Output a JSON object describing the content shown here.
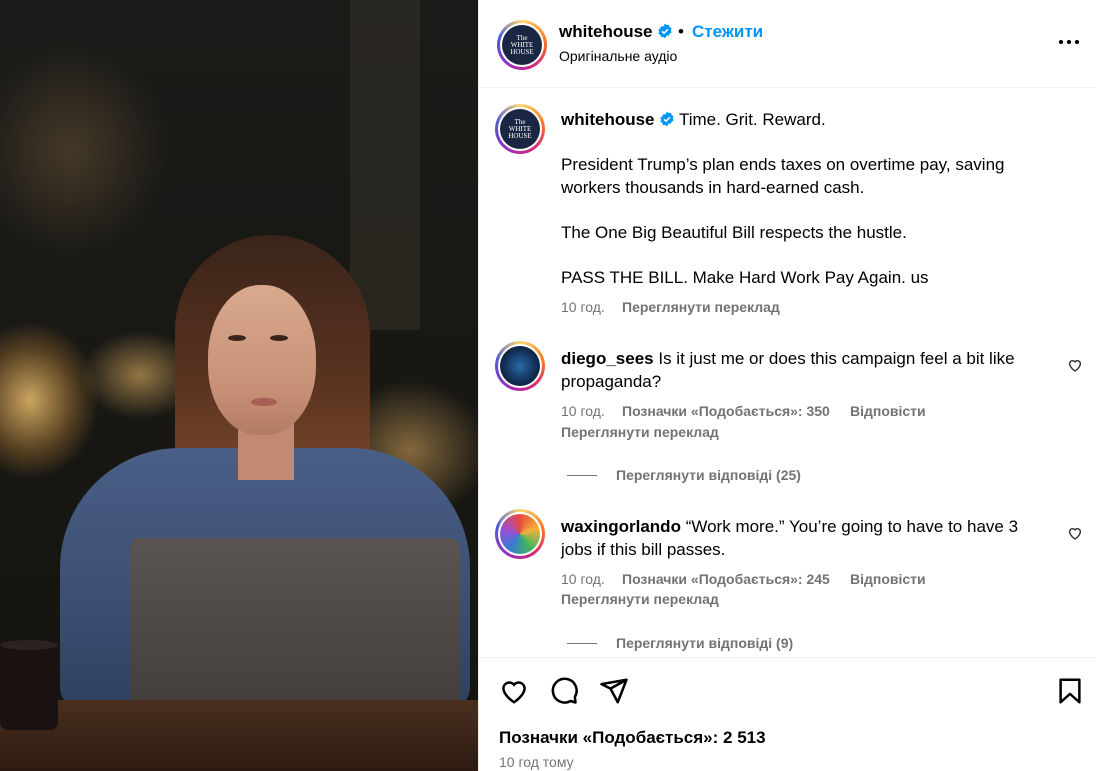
{
  "post": {
    "username": "whitehouse",
    "follow_label": "Стежити",
    "separator": "•",
    "audio_label": "Оригінальне аудіо",
    "avatar_text": [
      "The",
      "WHITE",
      "HOUSE"
    ]
  },
  "caption": {
    "username": "whitehouse",
    "first_line": "Time. Grit. Reward.",
    "paragraphs": [
      "President Trump’s plan ends taxes on overtime pay, saving workers thousands in hard-earned cash.",
      "The One Big Beautiful Bill respects the hustle.",
      "PASS THE BILL. Make Hard Work Pay Again. us"
    ],
    "time": "10 год.",
    "translate_label": "Переглянути переклад"
  },
  "comments": [
    {
      "username": "diego_sees",
      "text": "Is it just me or does this campaign feel a bit like propaganda?",
      "time": "10 год.",
      "likes": "Позначки «Подобається»: 350",
      "reply_label": "Відповісти",
      "translate_label": "Переглянути переклад",
      "view_replies": "Переглянути відповіді (25)"
    },
    {
      "username": "waxingorlando",
      "text": "“Work more.” You’re going to have to have 3 jobs if this bill passes.",
      "time": "10 год.",
      "likes": "Позначки «Подобається»: 245",
      "reply_label": "Відповісти",
      "translate_label": "Переглянути переклад",
      "view_replies": "Переглянути відповіді (9)"
    }
  ],
  "footer": {
    "likes": "Позначки «Подобається»: 2 513",
    "time_ago": "10 год тому"
  },
  "icons": {
    "more": "more-options-icon",
    "verified": "verified-badge-icon",
    "like": "heart-icon",
    "comment": "comment-icon",
    "share": "share-icon",
    "save": "bookmark-icon"
  },
  "colors": {
    "link_blue": "#0095f6",
    "secondary_text": "#737373",
    "verified_blue": "#0095f6"
  }
}
